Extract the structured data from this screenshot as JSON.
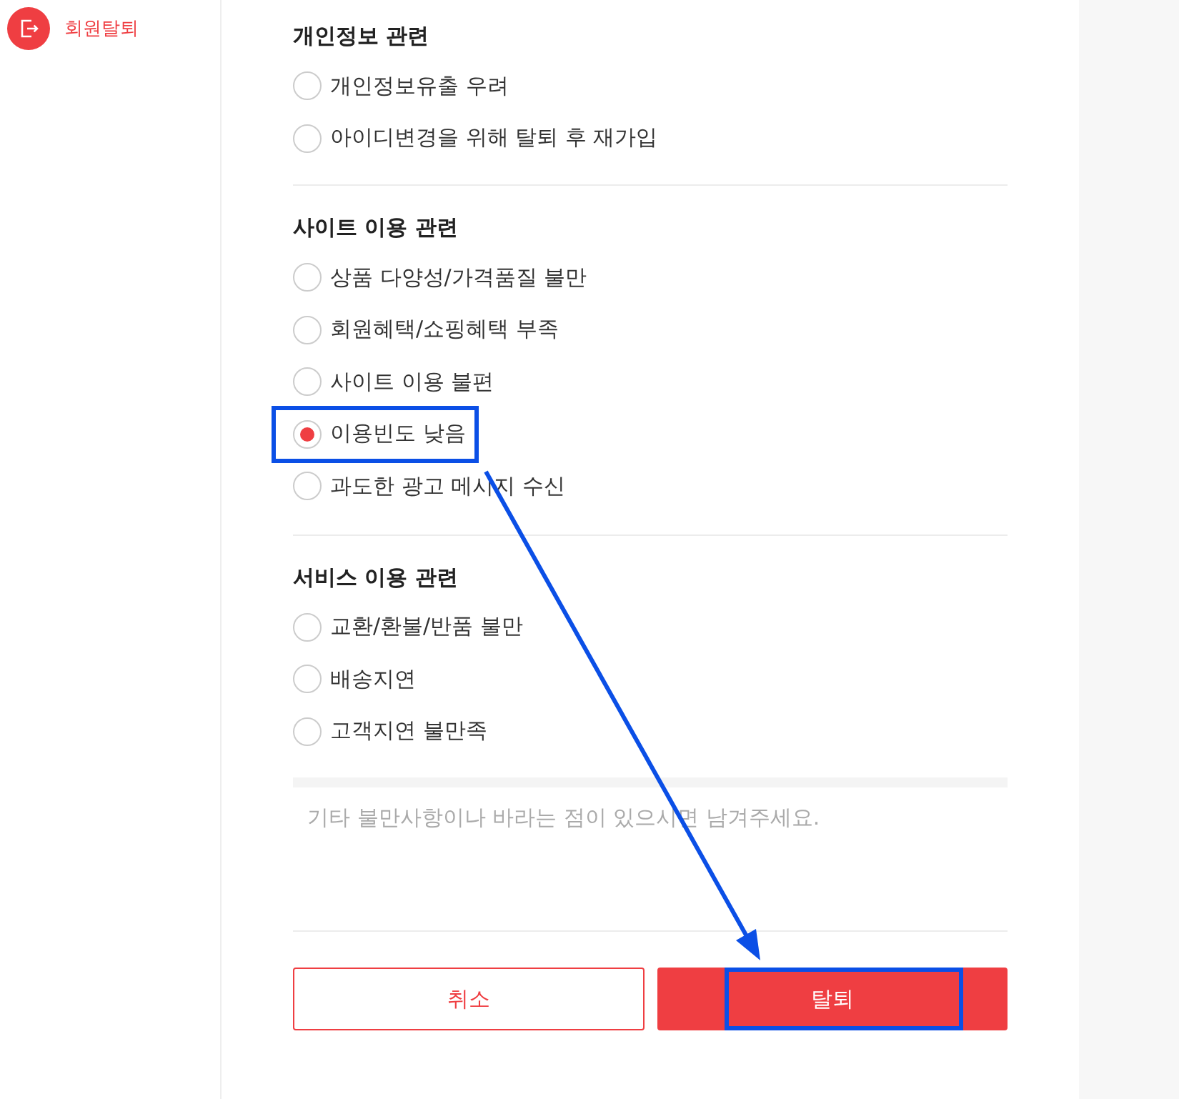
{
  "sidebar": {
    "items": [
      {
        "label": "회원탈퇴",
        "selected": true
      }
    ]
  },
  "reason_groups": [
    {
      "title": "개인정보 관련",
      "options": [
        {
          "label": "개인정보유출 우려",
          "selected": false
        },
        {
          "label": "아이디변경을 위해 탈퇴 후 재가입",
          "selected": false
        }
      ]
    },
    {
      "title": "사이트 이용 관련",
      "options": [
        {
          "label": "상품 다양성/가격품질 불만",
          "selected": false
        },
        {
          "label": "회원혜택/쇼핑혜택 부족",
          "selected": false
        },
        {
          "label": "사이트 이용 불편",
          "selected": false
        },
        {
          "label": "이용빈도 낮음",
          "selected": true
        },
        {
          "label": "과도한 광고 메시지 수신",
          "selected": false
        }
      ]
    },
    {
      "title": "서비스 이용 관련",
      "options": [
        {
          "label": "교환/환불/반품 불만",
          "selected": false
        },
        {
          "label": "배송지연",
          "selected": false
        },
        {
          "label": "고객지연 불만족",
          "selected": false
        }
      ]
    }
  ],
  "comment": {
    "placeholder": "기타 불만사항이나 바라는 점이 있으시면 남겨주세요."
  },
  "buttons": [
    {
      "label": "취소",
      "kind": "secondary"
    },
    {
      "label": "탈퇴",
      "kind": "primary"
    }
  ],
  "annotations": {
    "highlight_selected_option": true,
    "arrow": true,
    "highlight_primary_button": true
  }
}
